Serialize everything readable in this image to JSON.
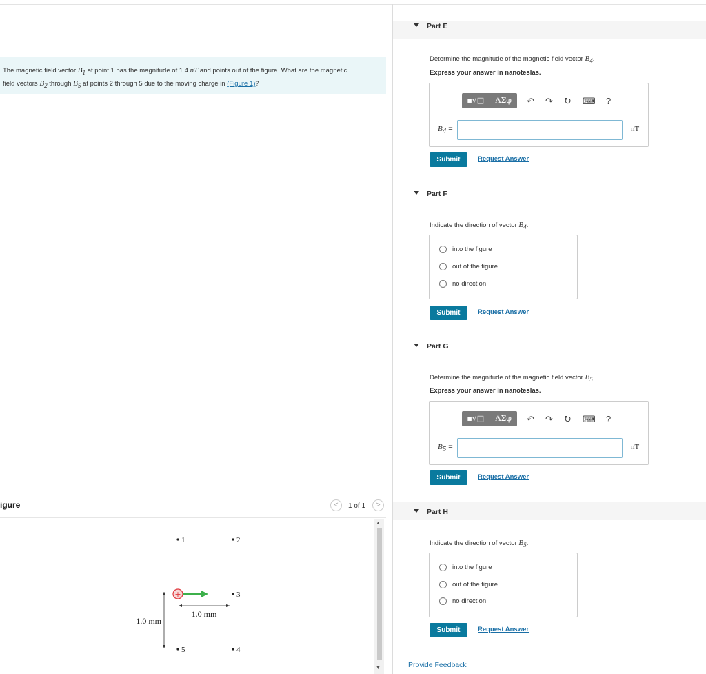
{
  "prompt": {
    "text_a": "The magnetic field vector ",
    "b1": "B",
    "b1_sub": "1",
    "text_b": " at point 1 has the magnitude of 1.4 ",
    "unit": "nT",
    "text_c": " and points out of the figure. What are the magnetic",
    "text_d": "field vectors ",
    "b2": "B",
    "b2_sub": "2",
    "text_e": " through ",
    "b5": "B",
    "b5_sub": "5",
    "text_f": " at points 2 through 5 due to the moving charge in ",
    "figure_link": "(Figure 1)",
    "text_g": "?"
  },
  "figure": {
    "title": "igure",
    "counter": "1 of 1",
    "prev": "<",
    "next": ">",
    "points": [
      "1",
      "2",
      "3",
      "4",
      "5"
    ],
    "charge": "+",
    "dim_horizontal": "1.0 mm",
    "dim_vertical": "1.0 mm"
  },
  "parts": {
    "e": {
      "title": "Part E",
      "question": "Determine the magnitude of the magnetic field vector ",
      "vec": "B",
      "vec_sub": "4",
      "instruction": "Express your answer in nanoteslas.",
      "var_label": "B",
      "var_sub": "4",
      "equals": " =",
      "unit": "nT",
      "input_value": ""
    },
    "f": {
      "title": "Part F",
      "question": "Indicate the direction of vector ",
      "vec": "B",
      "vec_sub": "4",
      "options": [
        "into the figure",
        "out of the figure",
        "no direction"
      ]
    },
    "g": {
      "title": "Part G",
      "question": "Determine the magnitude of the magnetic field vector ",
      "vec": "B",
      "vec_sub": "5",
      "instruction": "Express your answer in nanoteslas.",
      "var_label": "B",
      "var_sub": "5",
      "equals": " =",
      "unit": "nT",
      "input_value": ""
    },
    "h": {
      "title": "Part H",
      "question": "Indicate the direction of vector ",
      "vec": "B",
      "vec_sub": "5",
      "options": [
        "into the figure",
        "out of the figure",
        "no direction"
      ]
    }
  },
  "toolbar": {
    "templates": "▪√□",
    "greek": "AΣφ",
    "undo": "↶",
    "redo": "↷",
    "reset": "↻",
    "keyboard": "⌨",
    "help": "?"
  },
  "buttons": {
    "submit": "Submit",
    "request": "Request Answer"
  },
  "feedback": "Provide Feedback",
  "colors": {
    "accent": "#0a7a9e",
    "link": "#1a6fa6",
    "charge_red": "#e0393e",
    "arrow_green": "#3db04b"
  }
}
